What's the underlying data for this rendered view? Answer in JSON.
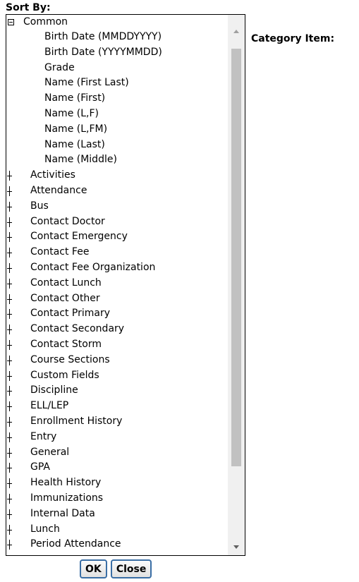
{
  "sort_by_label": "Sort By:",
  "category_item_label": "Category Item:",
  "tree": {
    "common": {
      "label": "Common",
      "expanded": true,
      "children": [
        "Birth Date (MMDDYYYY)",
        "Birth Date (YYYYMMDD)",
        "Grade",
        "Name (First Last)",
        "Name (First)",
        "Name (L,F)",
        "Name (L,FM)",
        "Name (Last)",
        "Name (Middle)"
      ]
    },
    "groups": [
      "Activities",
      "Attendance",
      "Bus",
      "Contact Doctor",
      "Contact Emergency",
      "Contact Fee",
      "Contact Fee Organization",
      "Contact Lunch",
      "Contact Other",
      "Contact Primary",
      "Contact Secondary",
      "Contact Storm",
      "Course Sections",
      "Custom Fields",
      "Discipline",
      "ELL/LEP",
      "Enrollment History",
      "Entry",
      "General",
      "GPA",
      "Health History",
      "Immunizations",
      "Internal Data",
      "Lunch",
      "Period Attendance"
    ]
  },
  "buttons": {
    "ok": "OK",
    "close": "Close"
  },
  "icons": {
    "collapse": "minus-box-icon",
    "expand": "plus-tree-icon",
    "scroll_up": "arrow-up-icon",
    "scroll_down": "arrow-down-icon"
  }
}
